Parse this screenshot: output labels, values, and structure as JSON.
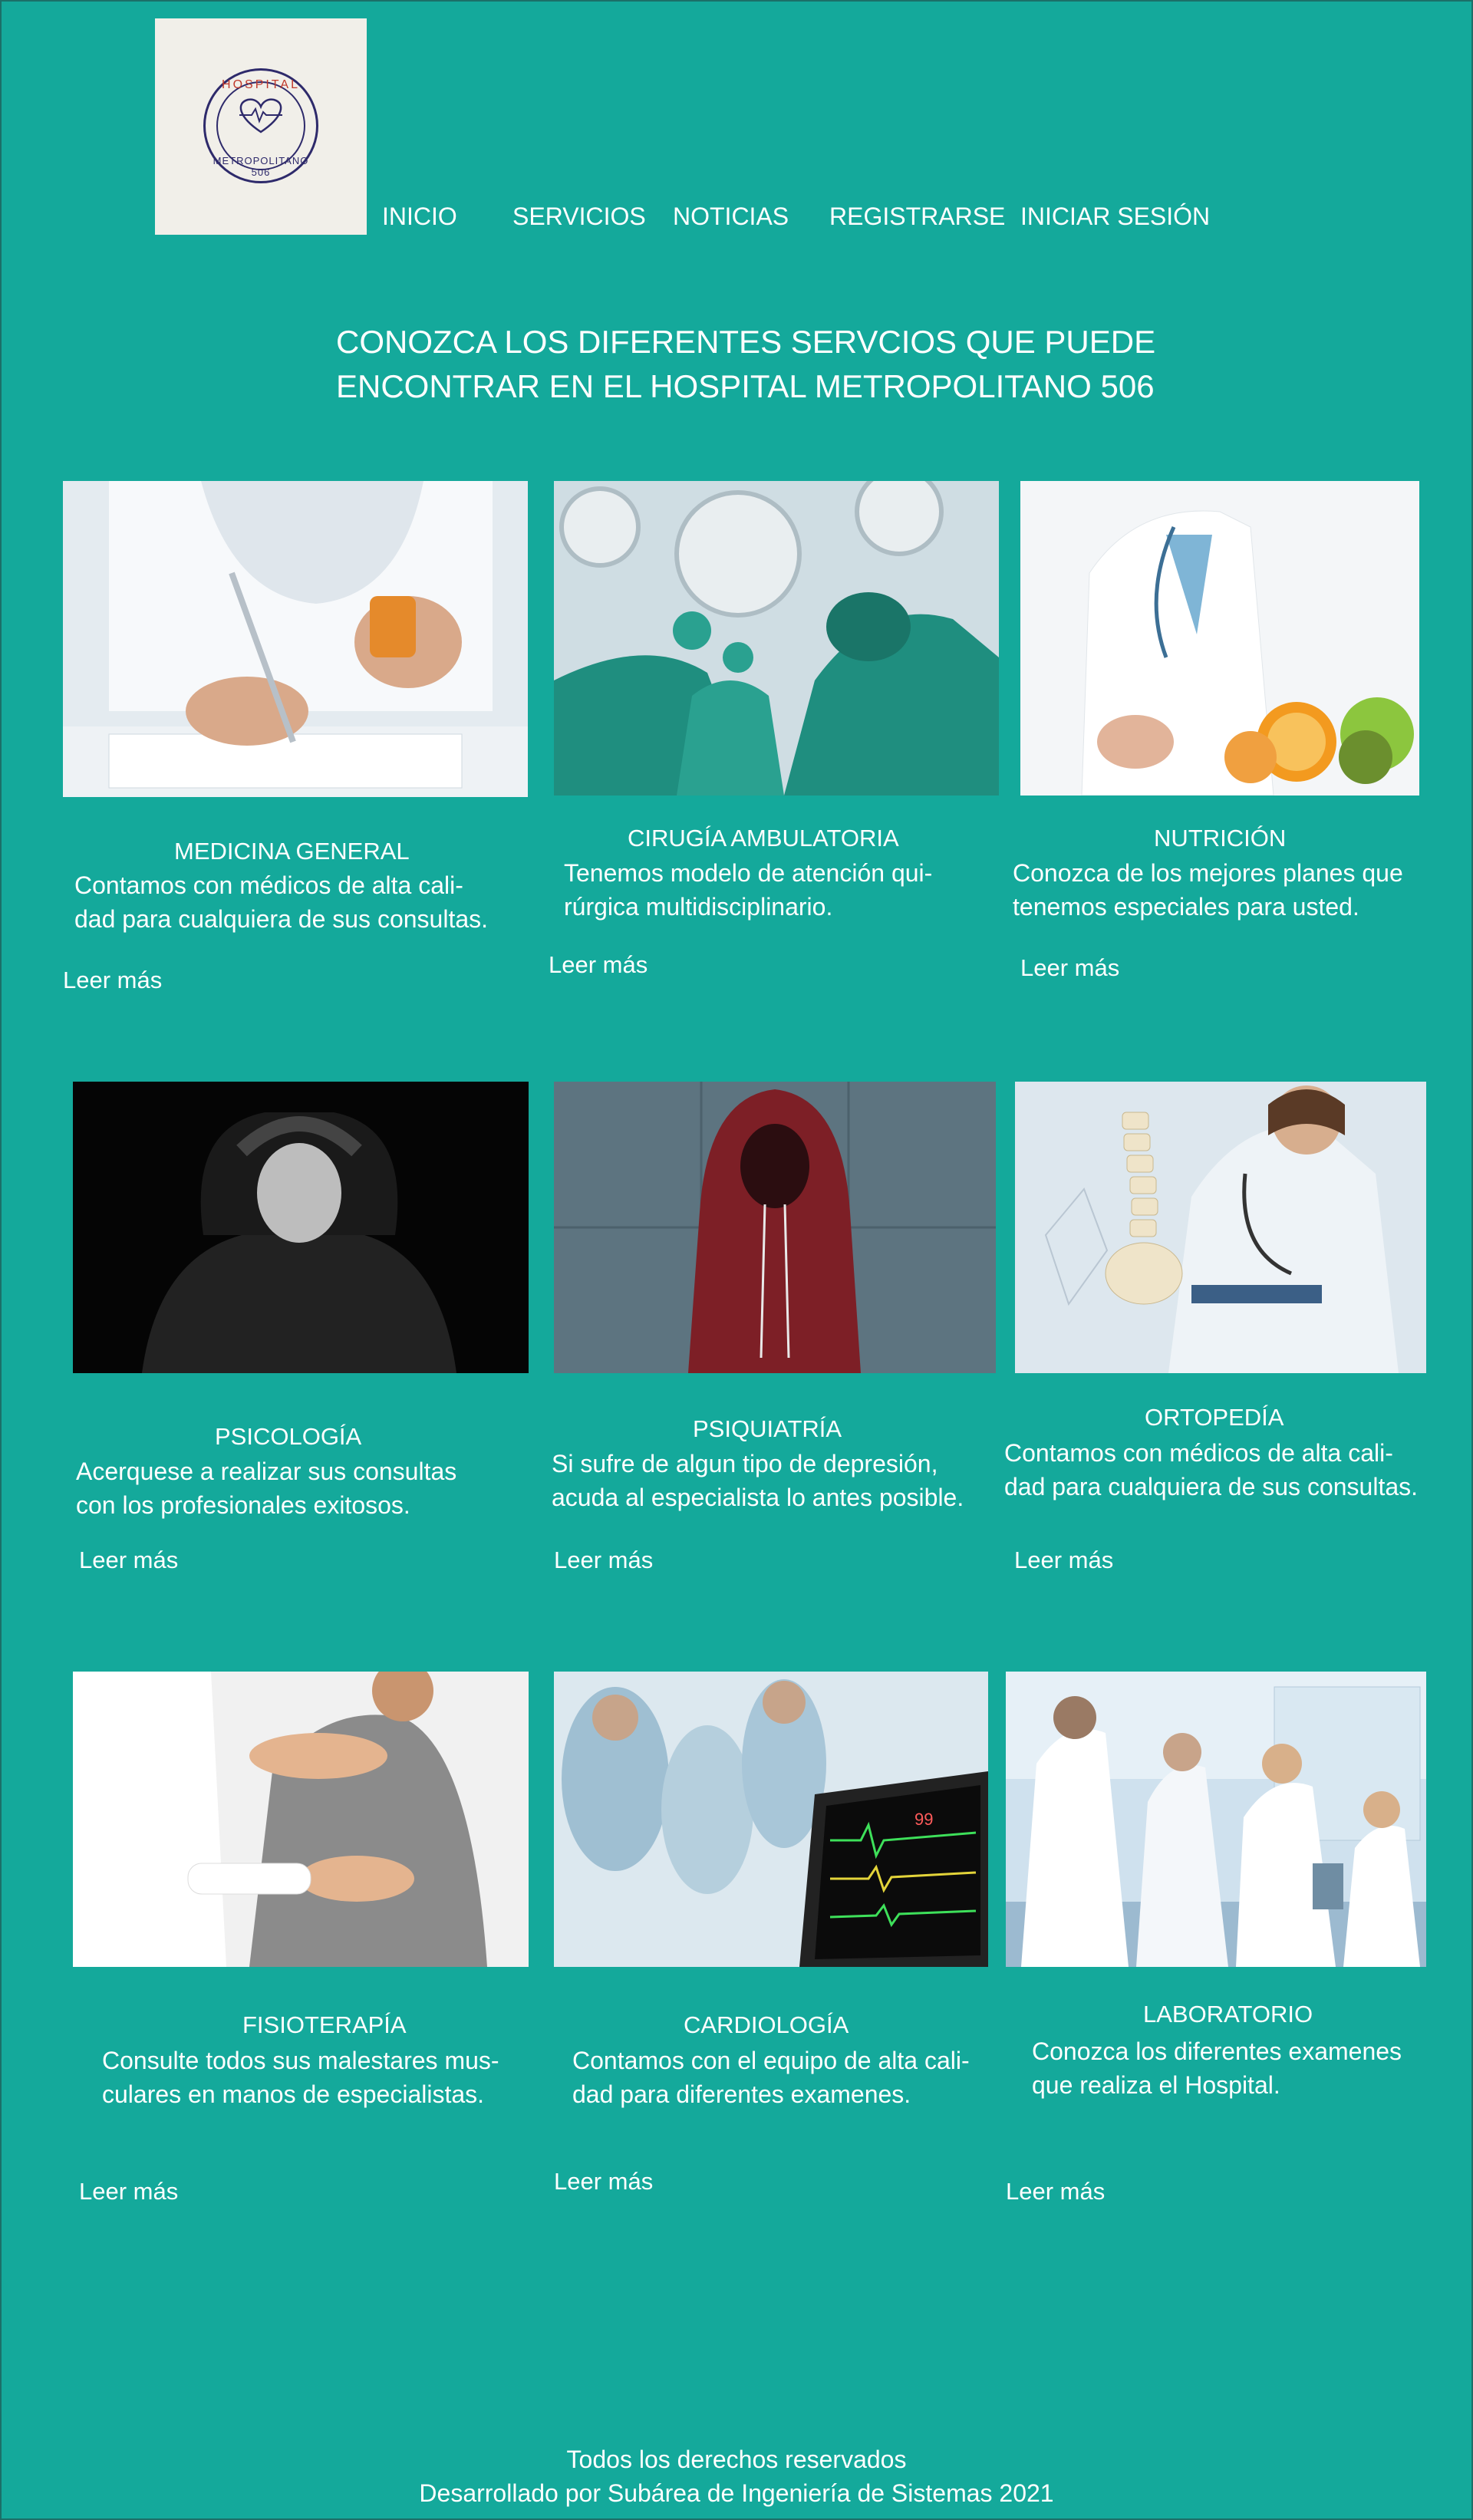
{
  "logo": {
    "top_text": "HOSPITAL",
    "bottom_text": "METROPOLITANO 506",
    "icon": "heart-pulse-icon"
  },
  "nav": {
    "inicio": "INICIO",
    "servicios": "SERVICIOS",
    "noticias": "NOTICIAS",
    "registrarse": "REGISTRARSE",
    "iniciar_sesion": "INICIAR SESIÓN"
  },
  "headline": {
    "line1": "CONOZCA LOS DIFERENTES SERVCIOS QUE PUEDE",
    "line2": "ENCONTRAR EN EL HOSPITAL METROPOLITANO 506"
  },
  "services": [
    {
      "title": "MEDICINA GENERAL",
      "desc1": "Contamos con médicos de alta cali-",
      "desc2": "dad para cualquiera de sus consultas.",
      "more": "Leer más",
      "image": "doctor-writing-prescription-photo"
    },
    {
      "title": "CIRUGÍA AMBULATORIA",
      "desc1": "Tenemos modelo de atención qui-",
      "desc2": "rúrgica multidisciplinario.",
      "more": "Leer más",
      "image": "surgeons-operating-room-photo"
    },
    {
      "title": "NUTRICIÓN",
      "desc1": "Conozca de los mejores planes que",
      "desc2": "tenemos especiales para usted.",
      "more": "Leer más",
      "image": "nutritionist-fruit-photo"
    },
    {
      "title": "PSICOLOGÍA",
      "desc1": "Acerquese a realizar sus consultas",
      "desc2": "con los profesionales exitosos.",
      "more": "Leer más",
      "image": "stressed-man-photo"
    },
    {
      "title": "PSIQUIATRÍA",
      "desc1": "Si sufre de algun tipo de depresión,",
      "desc2": "acuda al especialista lo antes posible.",
      "more": "Leer más",
      "image": "hooded-person-photo"
    },
    {
      "title": "ORTOPEDÍA",
      "desc1": "Contamos con médicos de alta cali-",
      "desc2": "dad para cualquiera de sus consultas.",
      "more": "Leer más",
      "image": "doctor-spine-model-photo"
    },
    {
      "title": "FISIOTERAPÍA",
      "desc1": "Consulte todos sus malestares mus-",
      "desc2": "culares en manos de especialistas.",
      "more": "Leer más",
      "image": "physiotherapy-shoulder-photo"
    },
    {
      "title": "CARDIOLOGÍA",
      "desc1": "Contamos con el equipo de alta cali-",
      "desc2": "dad para diferentes examenes.",
      "more": "Leer más",
      "image": "cardiac-monitor-surgery-photo"
    },
    {
      "title": "LABORATORIO",
      "desc1": "Conozca los diferentes examenes",
      "desc2": "que realiza el Hospital.",
      "more": "Leer más",
      "image": "laboratory-scientists-photo"
    }
  ],
  "footer": {
    "line1": "Todos los derechos reservados",
    "line2": "Desarrollado por Subárea de Ingeniería de Sistemas 2021"
  },
  "colors": {
    "background": "#14a99b",
    "text": "#ffffff",
    "logo_bg": "#f1efe9",
    "logo_ring": "#2e2a6b",
    "logo_accent": "#c0392b"
  }
}
